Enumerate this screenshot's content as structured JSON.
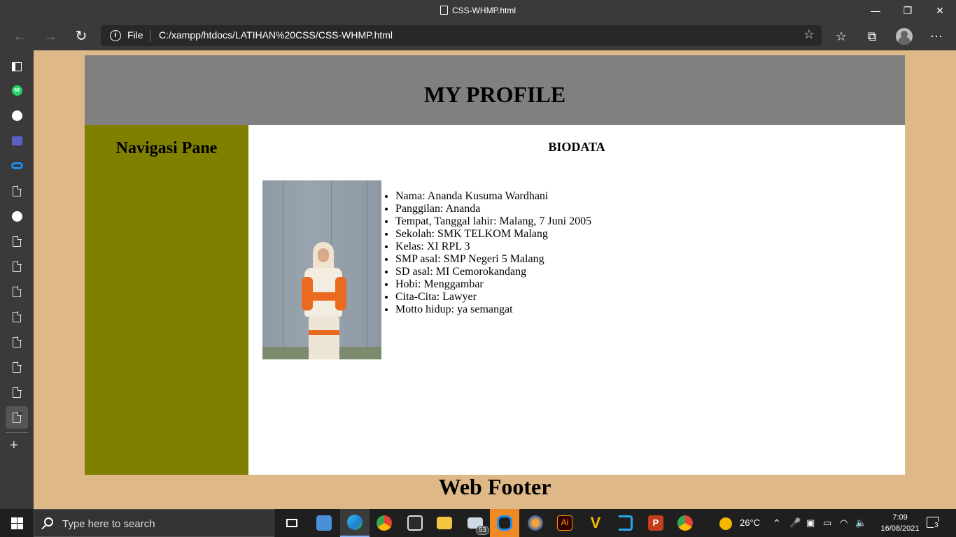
{
  "window": {
    "title": "CSS-WHMP.html",
    "minimize_glyph": "—",
    "restore_glyph": "❐",
    "close_glyph": "✕"
  },
  "browser": {
    "scheme_label": "File",
    "url": "C:/xampp/htdocs/LATIHAN%20CSS/CSS-WHMP.html",
    "back_glyph": "←",
    "forward_glyph": "→",
    "reload_glyph": "↻",
    "favorites_glyph": "☆",
    "collections_glyph": "⧉",
    "more_glyph": "⋯",
    "add_tab_glyph": "+"
  },
  "page": {
    "header_title": "MY PROFILE",
    "nav_title": "Navigasi Pane",
    "content_title": "BIODATA",
    "biodata": [
      "Nama: Ananda Kusuma Wardhani",
      "Panggilan: Ananda",
      "Tempat, Tanggal lahir: Malang, 7 Juni 2005",
      "Sekolah: SMK TELKOM Malang",
      "Kelas: XI RPL 3",
      "SMP asal: SMP Negeri 5 Malang",
      "SD asal: MI Cemorokandang",
      "Hobi: Menggambar",
      "Cita-Cita: Lawyer",
      "Motto hidup: ya semangat"
    ],
    "footer_text": "Web Footer",
    "colors": {
      "page_background": "#deb887",
      "header_background": "#808080",
      "nav_background": "#808000",
      "content_background": "#ffffff"
    }
  },
  "sidetabs": {
    "whatsapp_badge": "66"
  },
  "taskbar": {
    "search_placeholder": "Type here to search",
    "mail_badge": "53",
    "illustrator_label": "Ai",
    "v_label": "V",
    "powerpoint_label": "P",
    "temperature": "26°C",
    "time": "7:09",
    "date": "16/08/2021",
    "notification_count": "3"
  }
}
